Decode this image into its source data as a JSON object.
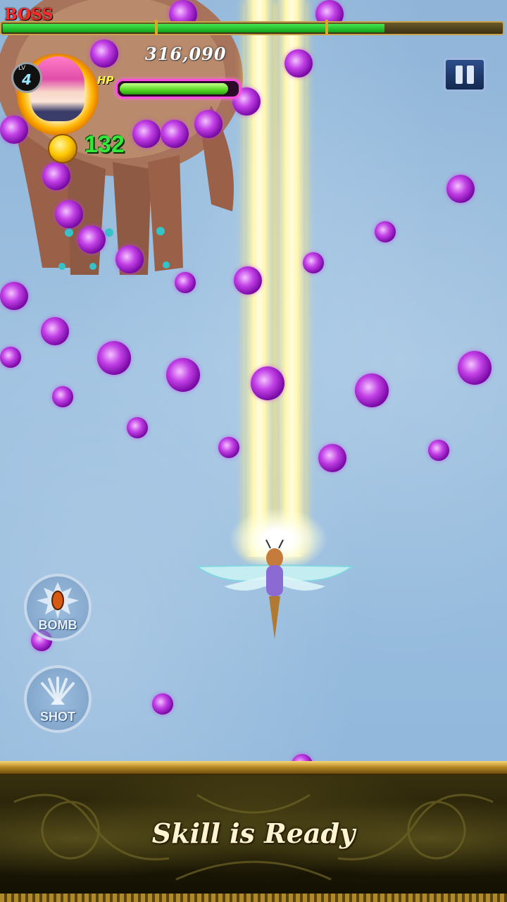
{
  "hud": {
    "boss_label": "BOSS",
    "boss_hp_fraction": 0.77,
    "score": "316,090",
    "level_label": "LV",
    "level": "4",
    "hp_label": "HP",
    "hp_fraction": 0.96,
    "gold": "132",
    "pause_icon": "pause-icon"
  },
  "controls": {
    "bomb_label": "BOMB",
    "shot_label": "SHOT"
  },
  "panel": {
    "message": "Skill is Ready"
  },
  "colors": {
    "boss_label": "#ff2a2a",
    "boss_hp": "#20c02a",
    "hp_border": "#ff4ae0",
    "gold_text": "#34e83a",
    "bullet": "#c240e6"
  }
}
